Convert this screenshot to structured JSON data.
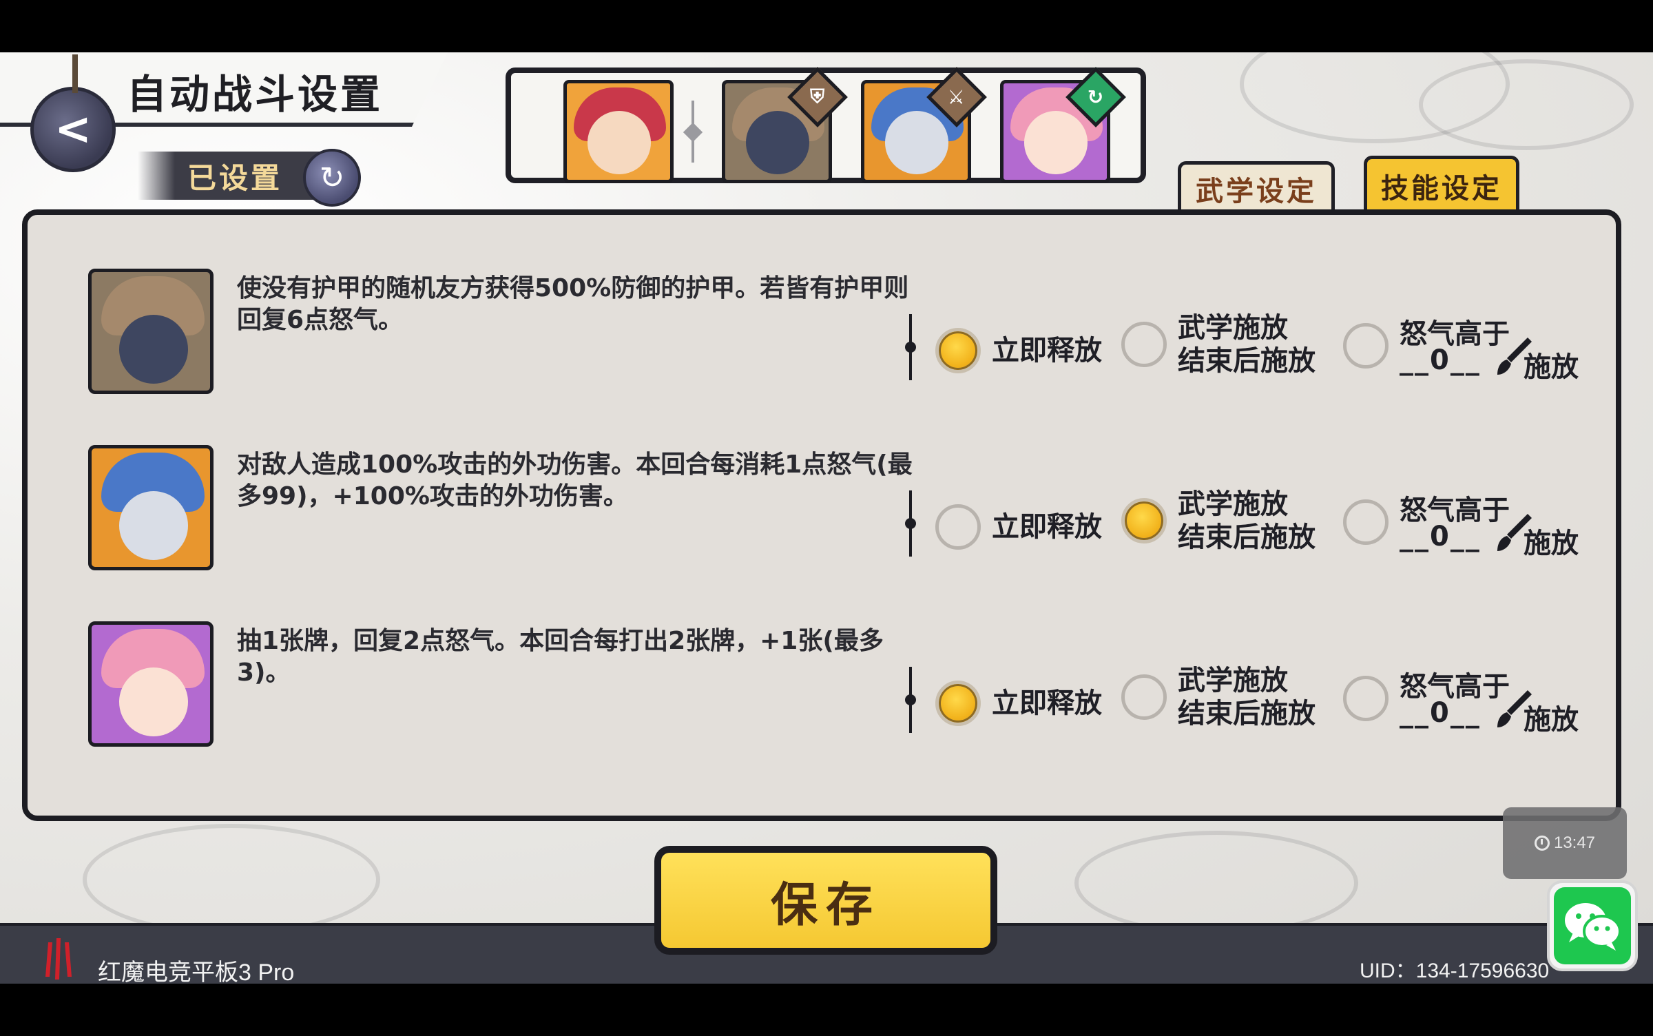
{
  "header": {
    "title": "自动战斗设置",
    "status": "已设置"
  },
  "tabs": [
    {
      "label": "武学设定",
      "active": false
    },
    {
      "label": "技能设定",
      "active": true
    }
  ],
  "skills": [
    {
      "description": "使没有护甲的随机友方获得500%防御的护甲。若皆有护甲则回复6点怒气。",
      "selected": "immediate"
    },
    {
      "description": "对敌人造成100%攻击的外功伤害。本回合每消耗1点怒气(最多99)，+100%攻击的外功伤害。",
      "selected": "after_martial"
    },
    {
      "description": "抽1张牌，回复2点怒气。本回合每打出2张牌，+1张(最多3)。",
      "selected": "immediate"
    }
  ],
  "options": {
    "immediate": "立即释放",
    "after_martial_line1": "武学施放",
    "after_martial_line2": "结束后施放",
    "rage_line1": "怒气高于",
    "rage_value": "__0__",
    "rage_cast": "施放"
  },
  "save_label": "保存",
  "footer": {
    "device": "红魔电竞平板3 Pro",
    "uid": "UID：134-17596630"
  },
  "clock": "13:47",
  "colors": {
    "accent_yellow": "#f5c832",
    "panel": "#e3dfda",
    "ink": "#1c1c22",
    "wechat_green": "#1ec74f"
  },
  "icons": {
    "back": "back-arrow-icon",
    "status": "auto-cycle-icon",
    "badge1": "shield-icon",
    "badge2": "sword-icon",
    "badge3": "cycle-icon",
    "brush": "brush-icon"
  }
}
